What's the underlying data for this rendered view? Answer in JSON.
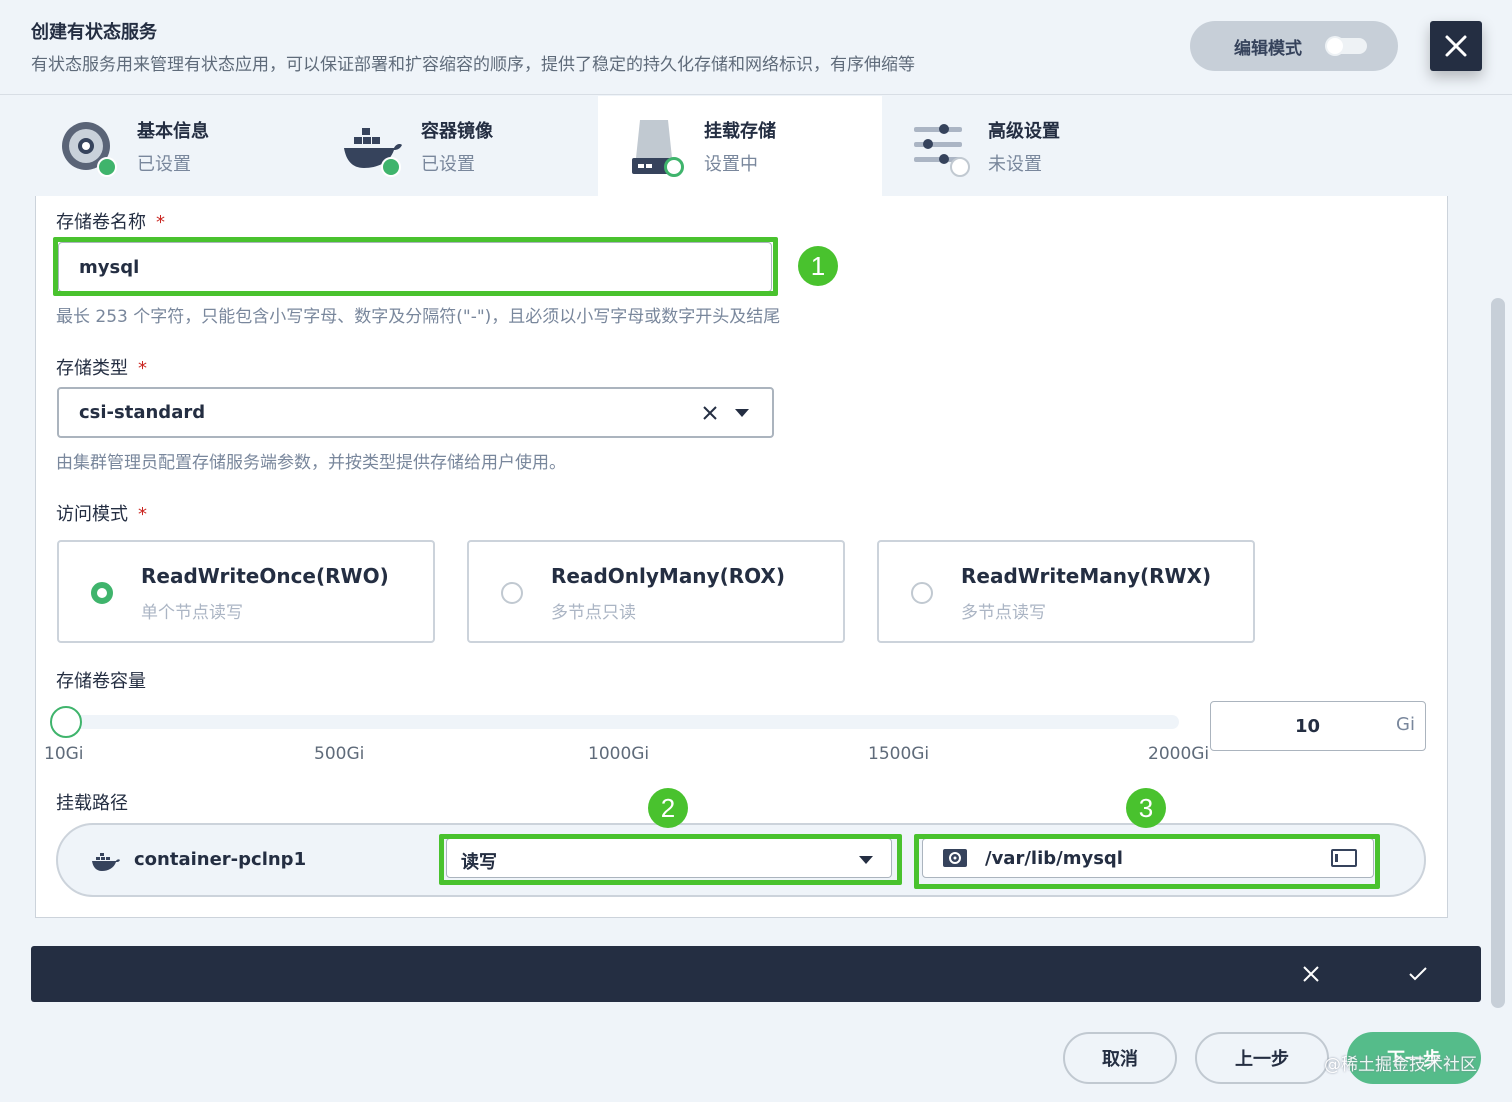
{
  "header": {
    "title": "创建有状态服务",
    "subtitle": "有状态服务用来管理有状态应用，可以保证部署和扩容缩容的顺序，提供了稳定的持久化存储和网络标识，有序伸缩等",
    "edit_mode_label": "编辑模式",
    "edit_mode_on": false
  },
  "steps": [
    {
      "name": "基本信息",
      "status": "已设置",
      "state": "done",
      "icon": "disc-icon"
    },
    {
      "name": "容器镜像",
      "status": "已设置",
      "state": "done",
      "icon": "docker-icon"
    },
    {
      "name": "挂载存储",
      "status": "设置中",
      "state": "current",
      "icon": "storage-drive-icon"
    },
    {
      "name": "高级设置",
      "status": "未设置",
      "state": "todo",
      "icon": "sliders-icon"
    }
  ],
  "form": {
    "volume_name": {
      "label": "存储卷名称",
      "required_mark": "*",
      "value": "mysql",
      "hint": "最长 253 个字符，只能包含小写字母、数字及分隔符(\"-\")，且必须以小写字母或数字开头及结尾",
      "callout": "1"
    },
    "storage_type": {
      "label": "存储类型",
      "required_mark": "*",
      "value": "csi-standard",
      "hint": "由集群管理员配置存储服务端参数，并按类型提供存储给用户使用。"
    },
    "access_mode": {
      "label": "访问模式",
      "required_mark": "*",
      "options": [
        {
          "title": "ReadWriteOnce(RWO)",
          "desc": "单个节点读写",
          "selected": true
        },
        {
          "title": "ReadOnlyMany(ROX)",
          "desc": "多节点只读",
          "selected": false
        },
        {
          "title": "ReadWriteMany(RWX)",
          "desc": "多节点读写",
          "selected": false
        }
      ]
    },
    "capacity": {
      "label": "存储卷容量",
      "ticks": [
        "10Gi",
        "500Gi",
        "1000Gi",
        "1500Gi",
        "2000Gi"
      ],
      "value": "10",
      "unit": "Gi",
      "slider_fraction": 0
    },
    "mount_path": {
      "label": "挂载路径",
      "container_name": "container-pclnp1",
      "mode_value": "读写",
      "path_value": "/var/lib/mysql",
      "callout_mode": "2",
      "callout_path": "3"
    }
  },
  "footer": {
    "cancel_label": "取消",
    "prev_label": "上一步",
    "next_label": "下一步",
    "watermark": "@稀土掘金技术社区"
  },
  "colors": {
    "accent_green": "#3fb46c",
    "highlight_green": "#49c22e",
    "dark": "#242e42",
    "required_red": "#ca2621"
  }
}
